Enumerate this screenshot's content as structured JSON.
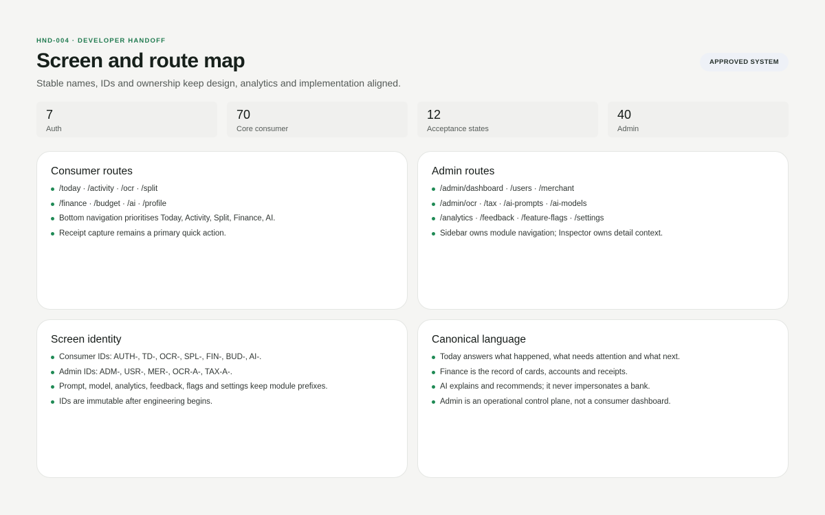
{
  "header": {
    "eyebrow": "HND-004 · DEVELOPER HANDOFF",
    "title": "Screen and route map",
    "subtitle": "Stable names, IDs and ownership keep design, analytics and implementation aligned.",
    "badge": "APPROVED SYSTEM"
  },
  "stats": [
    {
      "value": "7",
      "label": "Auth"
    },
    {
      "value": "70",
      "label": "Core consumer"
    },
    {
      "value": "12",
      "label": "Acceptance states"
    },
    {
      "value": "40",
      "label": "Admin"
    }
  ],
  "cards": {
    "consumer_routes": {
      "title": "Consumer routes",
      "items": [
        "/today · /activity · /ocr · /split",
        "/finance · /budget · /ai · /profile",
        "Bottom navigation prioritises Today, Activity, Split, Finance, AI.",
        "Receipt capture remains a primary quick action."
      ]
    },
    "admin_routes": {
      "title": "Admin routes",
      "items": [
        "/admin/dashboard · /users · /merchant",
        "/admin/ocr · /tax · /ai-prompts · /ai-models",
        "/analytics · /feedback · /feature-flags · /settings",
        "Sidebar owns module navigation; Inspector owns detail context."
      ]
    },
    "screen_identity": {
      "title": "Screen identity",
      "items": [
        "Consumer IDs: AUTH-, TD-, OCR-, SPL-, FIN-, BUD-, AI-.",
        "Admin IDs: ADM-, USR-, MER-, OCR-A-, TAX-A-.",
        "Prompt, model, analytics, feedback, flags and settings keep module prefixes.",
        "IDs are immutable after engineering begins."
      ]
    },
    "canonical_language": {
      "title": "Canonical language",
      "items": [
        "Today answers what happened, what needs attention and what next.",
        "Finance is the record of cards, accounts and receipts.",
        "AI explains and recommends; it never impersonates a bank.",
        "Admin is an operational control plane, not a consumer dashboard."
      ]
    }
  }
}
